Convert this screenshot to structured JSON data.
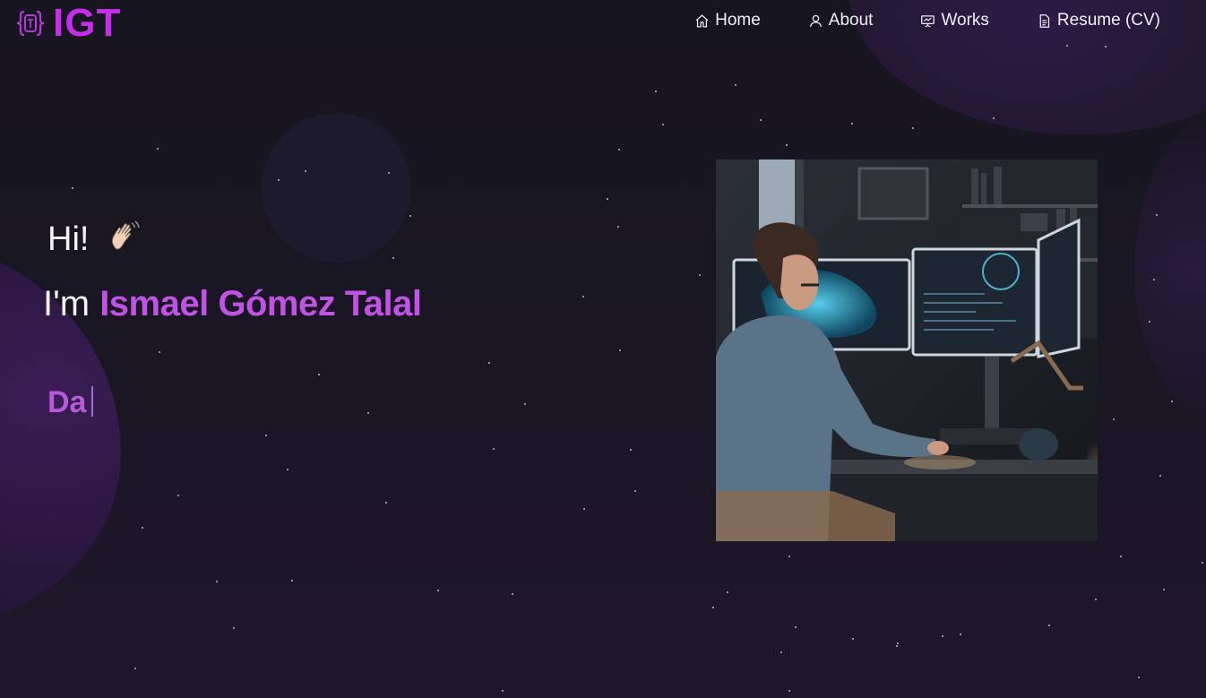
{
  "brand": {
    "logo_icon": "curly-braces-icon",
    "name": "IGT",
    "accent": "#c42ee8"
  },
  "nav": [
    {
      "label": "Home",
      "icon": "home-icon"
    },
    {
      "label": "About",
      "icon": "user-icon"
    },
    {
      "label": "Works",
      "icon": "presentation-icon"
    },
    {
      "label": "Resume (CV)",
      "icon": "document-icon"
    }
  ],
  "hero": {
    "greeting": "Hi!",
    "greeting_emoji": "waving-hand-icon",
    "intro_prefix": "I'm ",
    "name": "Ismael Gómez Talal",
    "typed_text": "Da",
    "name_color": "#c152e6",
    "image": "developer-at-monitors-illustration"
  },
  "colors": {
    "background": "#17141f",
    "text": "#f4f2f7"
  }
}
